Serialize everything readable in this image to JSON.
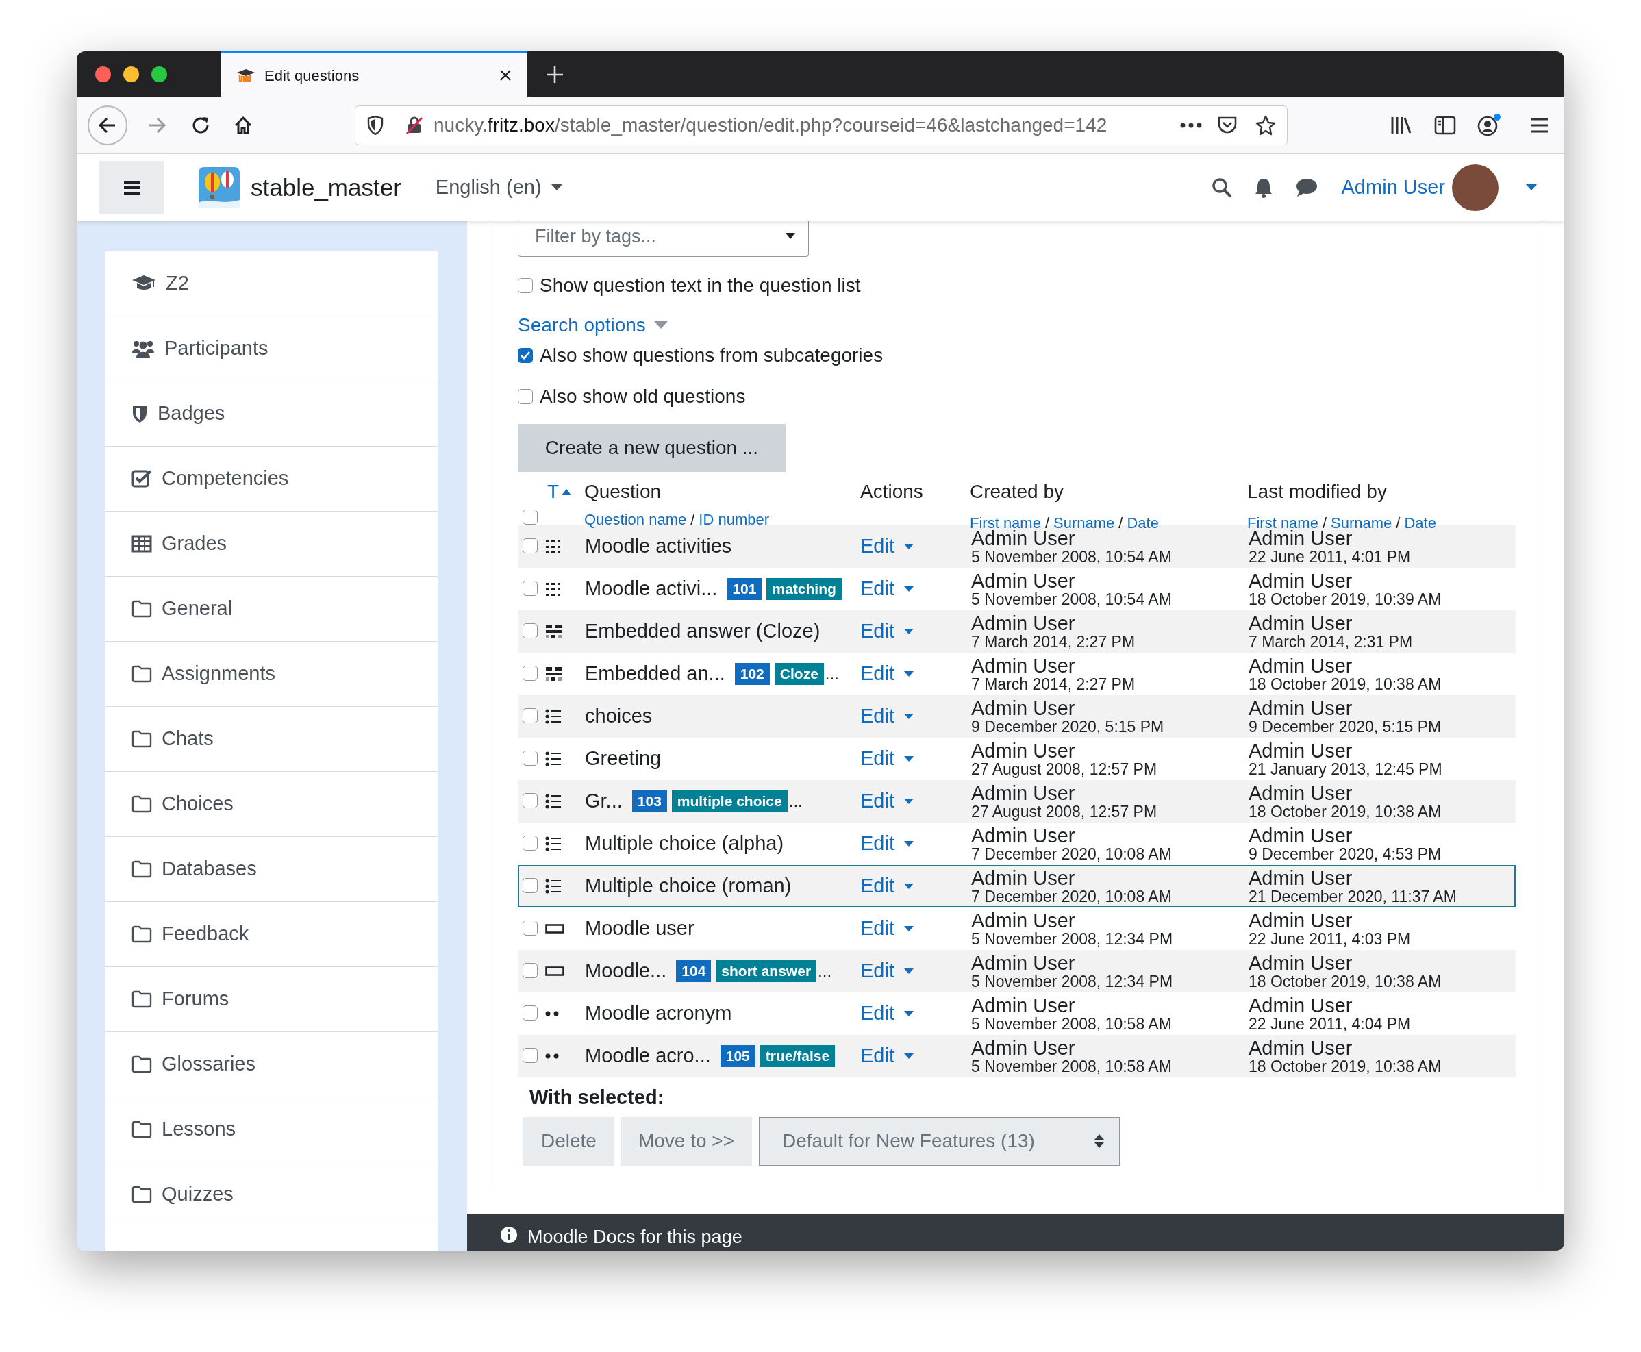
{
  "browser": {
    "tab_title": "Edit questions",
    "url": "nucky.**fritz.box**/stable_master/question/edit.php?courseid=46&lastchanged=142"
  },
  "navbar": {
    "site_name": "stable_master",
    "language": "English (en)",
    "user": "Admin User"
  },
  "sidebar": {
    "items": [
      {
        "label": "Z2",
        "kind": "course"
      },
      {
        "label": "Participants",
        "kind": "users"
      },
      {
        "label": "Badges",
        "kind": "shield"
      },
      {
        "label": "Competencies",
        "kind": "checkbox"
      },
      {
        "label": "Grades",
        "kind": "table"
      },
      {
        "label": "General",
        "kind": "folder"
      },
      {
        "label": "Assignments",
        "kind": "folder"
      },
      {
        "label": "Chats",
        "kind": "folder"
      },
      {
        "label": "Choices",
        "kind": "folder"
      },
      {
        "label": "Databases",
        "kind": "folder"
      },
      {
        "label": "Feedback",
        "kind": "folder"
      },
      {
        "label": "Forums",
        "kind": "folder"
      },
      {
        "label": "Glossaries",
        "kind": "folder"
      },
      {
        "label": "Lessons",
        "kind": "folder"
      },
      {
        "label": "Quizzes",
        "kind": "folder"
      }
    ]
  },
  "filter": {
    "placeholder": "Filter by tags..."
  },
  "options": [
    {
      "kind": "checkbox",
      "label": "Show question text in the question list",
      "checked": false
    },
    {
      "kind": "link",
      "label": "Search options"
    },
    {
      "kind": "checkbox",
      "label": "Also show questions from subcategories",
      "checked": true
    },
    {
      "kind": "checkbox",
      "label": "Also show old questions",
      "checked": false
    }
  ],
  "create_button": "Create a new question ...",
  "table": {
    "sort_label": "T",
    "select_all_checked": false,
    "separator": "/",
    "columns": {
      "question": {
        "title": "Question",
        "links": [
          "Question name",
          "ID number"
        ]
      },
      "actions": {
        "title": "Actions"
      },
      "created": {
        "title": "Created by",
        "links": [
          "First name",
          "Surname",
          "Date"
        ]
      },
      "modified": {
        "title": "Last modified by",
        "links": [
          "First name",
          "Surname",
          "Date"
        ]
      }
    },
    "rows": [
      {
        "kind": "matching",
        "name": "Moodle activities",
        "edit": "Edit",
        "created_by": "Admin User",
        "created": "5 November 2008, 10:54 AM",
        "modified_by": "Admin User",
        "modified": "22 June 2011, 4:01 PM",
        "checked": false,
        "selected": false
      },
      {
        "kind": "matching",
        "name": "Moodle activi...",
        "id_badge": "101",
        "type_badge": "matching",
        "edit": "Edit",
        "created_by": "Admin User",
        "created": "5 November 2008, 10:54 AM",
        "modified_by": "Admin User",
        "modified": "18 October 2019, 10:39 AM",
        "checked": false,
        "selected": false
      },
      {
        "kind": "multianswer",
        "name": "Embedded answer (Cloze)",
        "edit": "Edit",
        "created_by": "Admin User",
        "created": "7 March 2014, 2:27 PM",
        "modified_by": "Admin User",
        "modified": "7 March 2014, 2:31 PM",
        "checked": false,
        "selected": false
      },
      {
        "kind": "multianswer",
        "name": "Embedded an...",
        "id_badge": "102",
        "type_badge": "Cloze",
        "tail": "...",
        "edit": "Edit",
        "created_by": "Admin User",
        "created": "7 March 2014, 2:27 PM",
        "modified_by": "Admin User",
        "modified": "18 October 2019, 10:38 AM",
        "checked": false,
        "selected": false
      },
      {
        "kind": "multichoice",
        "name": "choices",
        "edit": "Edit",
        "created_by": "Admin User",
        "created": "9 December 2020, 5:15 PM",
        "modified_by": "Admin User",
        "modified": "9 December 2020, 5:15 PM",
        "checked": false,
        "selected": false
      },
      {
        "kind": "multichoice",
        "name": "Greeting",
        "edit": "Edit",
        "created_by": "Admin User",
        "created": "27 August 2008, 12:57 PM",
        "modified_by": "Admin User",
        "modified": "21 January 2013, 12:45 PM",
        "checked": false,
        "selected": false
      },
      {
        "kind": "multichoice",
        "name": "Gr...",
        "id_badge": "103",
        "type_badge": "multiple choice",
        "tail": "...",
        "edit": "Edit",
        "created_by": "Admin User",
        "created": "27 August 2008, 12:57 PM",
        "modified_by": "Admin User",
        "modified": "18 October 2019, 10:38 AM",
        "checked": false,
        "selected": false
      },
      {
        "kind": "multichoice",
        "name": "Multiple choice (alpha)",
        "edit": "Edit",
        "created_by": "Admin User",
        "created": "7 December 2020, 10:08 AM",
        "modified_by": "Admin User",
        "modified": "9 December 2020, 4:53 PM",
        "checked": false,
        "selected": false
      },
      {
        "kind": "multichoice",
        "name": "Multiple choice (roman)",
        "edit": "Edit",
        "created_by": "Admin User",
        "created": "7 December 2020, 10:08 AM",
        "modified_by": "Admin User",
        "modified": "21 December 2020, 11:37 AM",
        "checked": false,
        "selected": true
      },
      {
        "kind": "shortanswer",
        "name": "Moodle user",
        "edit": "Edit",
        "created_by": "Admin User",
        "created": "5 November 2008, 12:34 PM",
        "modified_by": "Admin User",
        "modified": "22 June 2011, 4:03 PM",
        "checked": false,
        "selected": false
      },
      {
        "kind": "shortanswer",
        "name": "Moodle...",
        "id_badge": "104",
        "type_badge": "short answer",
        "tail": "...",
        "edit": "Edit",
        "created_by": "Admin User",
        "created": "5 November 2008, 12:34 PM",
        "modified_by": "Admin User",
        "modified": "18 October 2019, 10:38 AM",
        "checked": false,
        "selected": false
      },
      {
        "kind": "truefalse",
        "name": "Moodle acronym",
        "edit": "Edit",
        "created_by": "Admin User",
        "created": "5 November 2008, 10:58 AM",
        "modified_by": "Admin User",
        "modified": "22 June 2011, 4:04 PM",
        "checked": false,
        "selected": false
      },
      {
        "kind": "truefalse",
        "name": "Moodle acro...",
        "id_badge": "105",
        "type_badge": "true/false",
        "edit": "Edit",
        "created_by": "Admin User",
        "created": "5 November 2008, 10:58 AM",
        "modified_by": "Admin User",
        "modified": "18 October 2019, 10:38 AM",
        "checked": false,
        "selected": false
      }
    ]
  },
  "bulk": {
    "label": "With selected:",
    "buttons": [
      "Delete",
      "Move to >>"
    ],
    "category_select": "Default for New Features (13)"
  },
  "footer": {
    "docs_link": "Moodle Docs for this page"
  }
}
